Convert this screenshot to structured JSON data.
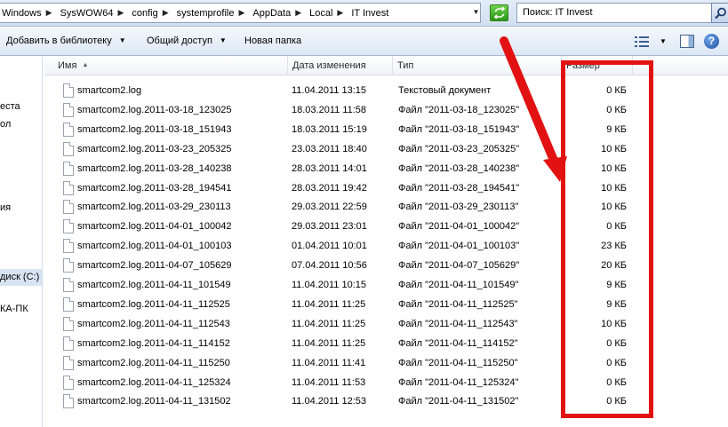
{
  "address": {
    "crumbs": [
      "Windows",
      "SysWOW64",
      "config",
      "systemprofile",
      "AppData",
      "Local",
      "IT Invest"
    ]
  },
  "search": {
    "value": "Поиск: IT Invest"
  },
  "toolbar": {
    "add_to_library": "Добавить в библиотеку",
    "share": "Общий доступ",
    "new_folder": "Новая папка"
  },
  "nav": {
    "items": [
      "еста",
      "ол",
      "ия",
      "диск (C:)",
      "КА-ПК"
    ]
  },
  "columns": {
    "name": "Имя",
    "date": "Дата изменения",
    "type": "Тип",
    "size": "Размер"
  },
  "files": [
    {
      "name": "smartcom2.log",
      "date": "11.04.2011 13:15",
      "type": "Текстовый документ",
      "size": "0 КБ"
    },
    {
      "name": "smartcom2.log.2011-03-18_123025",
      "date": "18.03.2011 11:58",
      "type": "Файл \"2011-03-18_123025\"",
      "size": "0 КБ"
    },
    {
      "name": "smartcom2.log.2011-03-18_151943",
      "date": "18.03.2011 15:19",
      "type": "Файл \"2011-03-18_151943\"",
      "size": "9 КБ"
    },
    {
      "name": "smartcom2.log.2011-03-23_205325",
      "date": "23.03.2011 18:40",
      "type": "Файл \"2011-03-23_205325\"",
      "size": "10 КБ"
    },
    {
      "name": "smartcom2.log.2011-03-28_140238",
      "date": "28.03.2011 14:01",
      "type": "Файл \"2011-03-28_140238\"",
      "size": "10 КБ"
    },
    {
      "name": "smartcom2.log.2011-03-28_194541",
      "date": "28.03.2011 19:42",
      "type": "Файл \"2011-03-28_194541\"",
      "size": "10 КБ"
    },
    {
      "name": "smartcom2.log.2011-03-29_230113",
      "date": "29.03.2011 22:59",
      "type": "Файл \"2011-03-29_230113\"",
      "size": "10 КБ"
    },
    {
      "name": "smartcom2.log.2011-04-01_100042",
      "date": "29.03.2011 23:01",
      "type": "Файл \"2011-04-01_100042\"",
      "size": "0 КБ"
    },
    {
      "name": "smartcom2.log.2011-04-01_100103",
      "date": "01.04.2011 10:01",
      "type": "Файл \"2011-04-01_100103\"",
      "size": "23 КБ"
    },
    {
      "name": "smartcom2.log.2011-04-07_105629",
      "date": "07.04.2011 10:56",
      "type": "Файл \"2011-04-07_105629\"",
      "size": "20 КБ"
    },
    {
      "name": "smartcom2.log.2011-04-11_101549",
      "date": "11.04.2011 10:15",
      "type": "Файл \"2011-04-11_101549\"",
      "size": "9 КБ"
    },
    {
      "name": "smartcom2.log.2011-04-11_112525",
      "date": "11.04.2011 11:25",
      "type": "Файл \"2011-04-11_112525\"",
      "size": "9 КБ"
    },
    {
      "name": "smartcom2.log.2011-04-11_112543",
      "date": "11.04.2011 11:25",
      "type": "Файл \"2011-04-11_112543\"",
      "size": "10 КБ"
    },
    {
      "name": "smartcom2.log.2011-04-11_114152",
      "date": "11.04.2011 11:25",
      "type": "Файл \"2011-04-11_114152\"",
      "size": "0 КБ"
    },
    {
      "name": "smartcom2.log.2011-04-11_115250",
      "date": "11.04.2011 11:41",
      "type": "Файл \"2011-04-11_115250\"",
      "size": "0 КБ"
    },
    {
      "name": "smartcom2.log.2011-04-11_125324",
      "date": "11.04.2011 11:53",
      "type": "Файл \"2011-04-11_125324\"",
      "size": "0 КБ"
    },
    {
      "name": "smartcom2.log.2011-04-11_131502",
      "date": "11.04.2011 12:53",
      "type": "Файл \"2011-04-11_131502\"",
      "size": "0 КБ"
    }
  ],
  "icons": {
    "refresh": "refresh-icon",
    "search": "search-icon",
    "views": "views-icon",
    "pane": "preview-pane-icon",
    "help": "help-icon",
    "file": "text-file-icon"
  },
  "colors": {
    "annotation": "#e21212",
    "selection": "#d9e4f3"
  }
}
